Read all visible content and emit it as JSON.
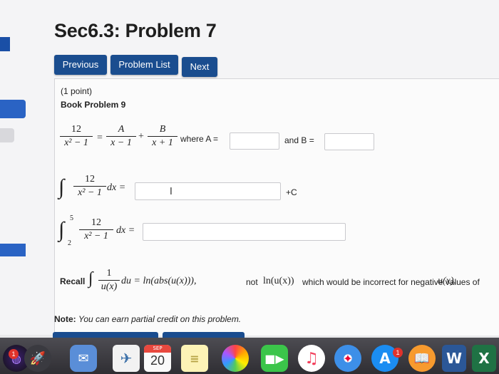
{
  "page": {
    "title": "Sec6.3: Problem 7"
  },
  "nav": {
    "previous": "Previous",
    "problem_list": "Problem List",
    "next": "Next"
  },
  "problem": {
    "points": "(1 point)",
    "book": "Book Problem 9",
    "q1": {
      "num": "12",
      "den": "x² − 1",
      "eq": "=",
      "a_num": "A",
      "a_den": "x − 1",
      "plus": "+",
      "b_num": "B",
      "b_den": "x + 1",
      "where_a": "where A =",
      "and_b": "and B =",
      "a_value": "",
      "b_value": ""
    },
    "q2": {
      "integral": "∫",
      "num": "12",
      "den": "x² − 1",
      "dx": "dx =",
      "value": "",
      "plus_c": "+C"
    },
    "q3": {
      "integral": "∫",
      "upper": "5",
      "lower": "2",
      "num": "12",
      "den": "x² − 1",
      "dx": "dx =",
      "value": ""
    },
    "recall": {
      "label": "Recall",
      "integral": "∫",
      "num": "1",
      "den": "u(x)",
      "du": "du = ln(abs(u(x))),",
      "not": "not",
      "ln": "ln(u(x))",
      "rest": "which would be incorrect for negative values of",
      "ux": "u(x)."
    },
    "note": {
      "label": "Note:",
      "text": "You can earn partial credit on this problem."
    }
  },
  "dock": {
    "siri_badge": "1",
    "calendar_month": "SEP",
    "calendar_day": "20",
    "appstore_badge": "1",
    "word_letter": "W",
    "excel_letter": "X",
    "icons": [
      "siri-icon",
      "launchpad-icon",
      "mail-icon",
      "calendar-icon",
      "notes-icon",
      "photos-icon",
      "facetime-icon",
      "music-icon",
      "safari-icon",
      "app-store-icon",
      "books-icon",
      "word-icon",
      "excel-icon"
    ]
  }
}
